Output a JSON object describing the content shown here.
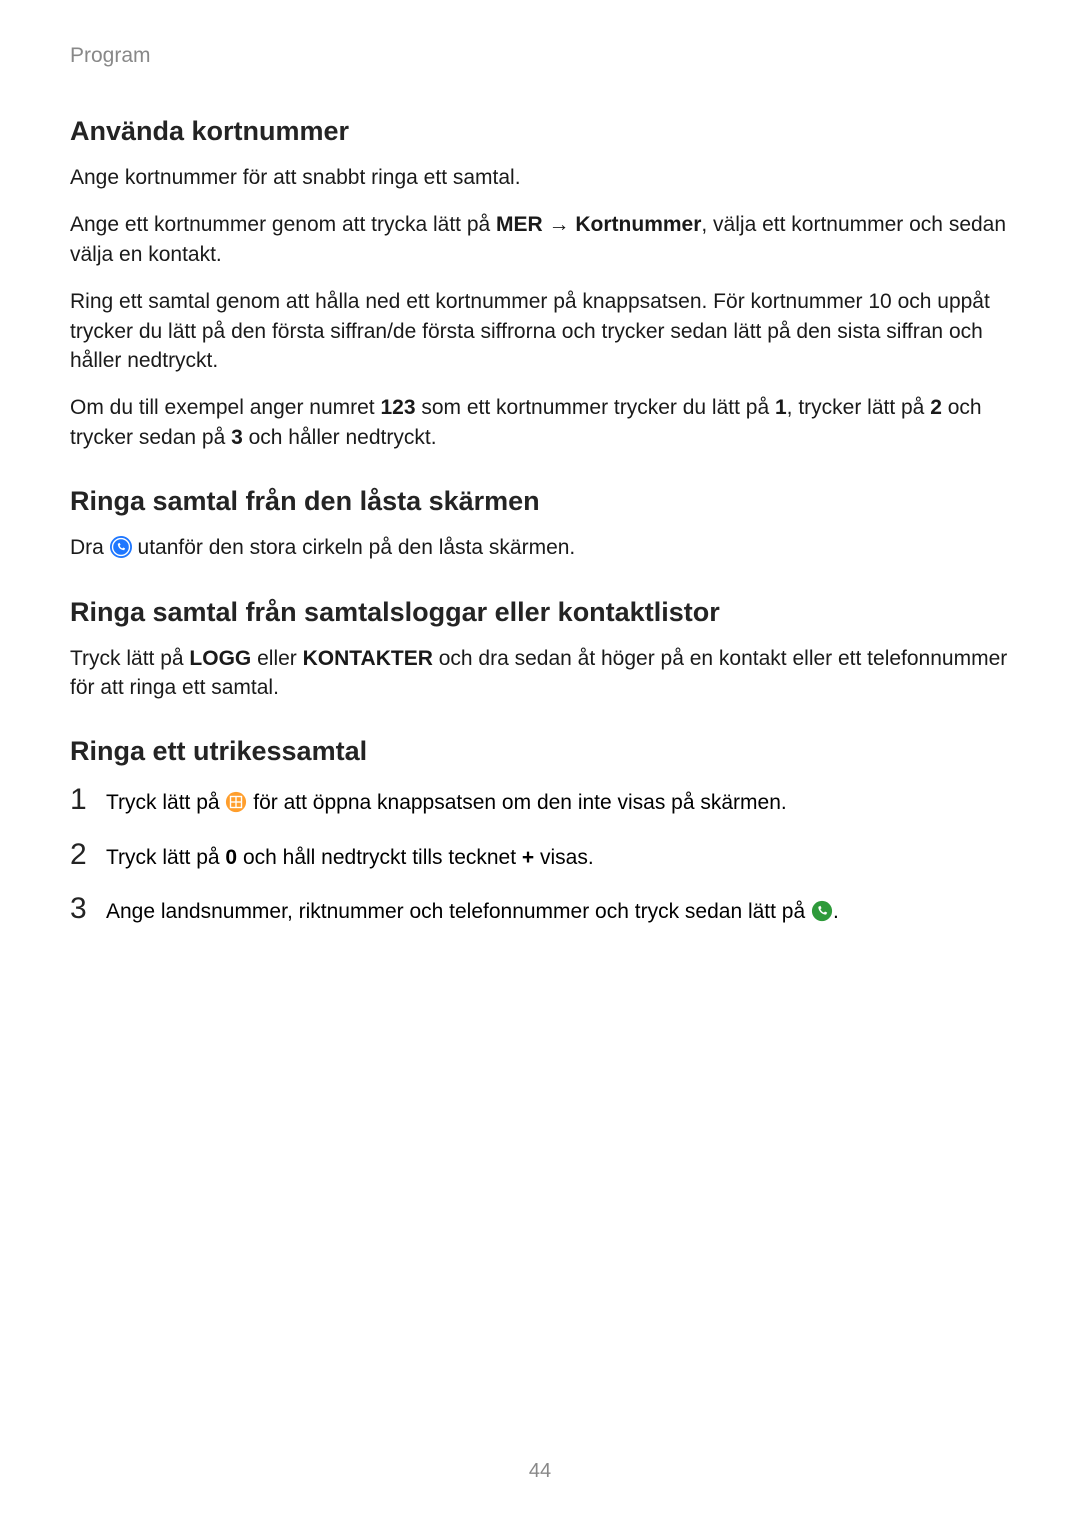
{
  "header": "Program",
  "page_number": "44",
  "sections": {
    "s1": {
      "title": "Använda kortnummer",
      "p1": "Ange kortnummer för att snabbt ringa ett samtal.",
      "p2_a": "Ange ett kortnummer genom att trycka lätt på ",
      "p2_b": "MER",
      "p2_arrow": " → ",
      "p2_c": "Kortnummer",
      "p2_d": ", välja ett kortnummer och sedan välja en kontakt.",
      "p3": "Ring ett samtal genom att hålla ned ett kortnummer på knappsatsen. För kortnummer 10 och uppåt trycker du lätt på den första siffran/de första siffrorna och trycker sedan lätt på den sista siffran och håller nedtryckt.",
      "p4_a": "Om du till exempel anger numret ",
      "p4_b": "123",
      "p4_c": " som ett kortnummer trycker du lätt på ",
      "p4_d": "1",
      "p4_e": ", trycker lätt på ",
      "p4_f": "2",
      "p4_g": " och trycker sedan på ",
      "p4_h": "3",
      "p4_i": " och håller nedtryckt."
    },
    "s2": {
      "title": "Ringa samtal från den låsta skärmen",
      "p1_a": "Dra ",
      "p1_b": " utanför den stora cirkeln på den låsta skärmen."
    },
    "s3": {
      "title": "Ringa samtal från samtalsloggar eller kontaktlistor",
      "p1_a": "Tryck lätt på ",
      "p1_b": "LOGG",
      "p1_c": " eller ",
      "p1_d": "KONTAKTER",
      "p1_e": " och dra sedan åt höger på en kontakt eller ett telefonnummer för att ringa ett samtal."
    },
    "s4": {
      "title": "Ringa ett utrikessamtal",
      "steps": {
        "n1": "1",
        "s1_a": "Tryck lätt på ",
        "s1_b": " för att öppna knappsatsen om den inte visas på skärmen.",
        "n2": "2",
        "s2_a": "Tryck lätt på ",
        "s2_b": "0",
        "s2_c": " och håll nedtryckt tills tecknet ",
        "s2_d": "+",
        "s2_e": " visas.",
        "n3": "3",
        "s3_a": "Ange landsnummer, riktnummer och telefonnummer och tryck sedan lätt på ",
        "s3_b": "."
      }
    }
  }
}
